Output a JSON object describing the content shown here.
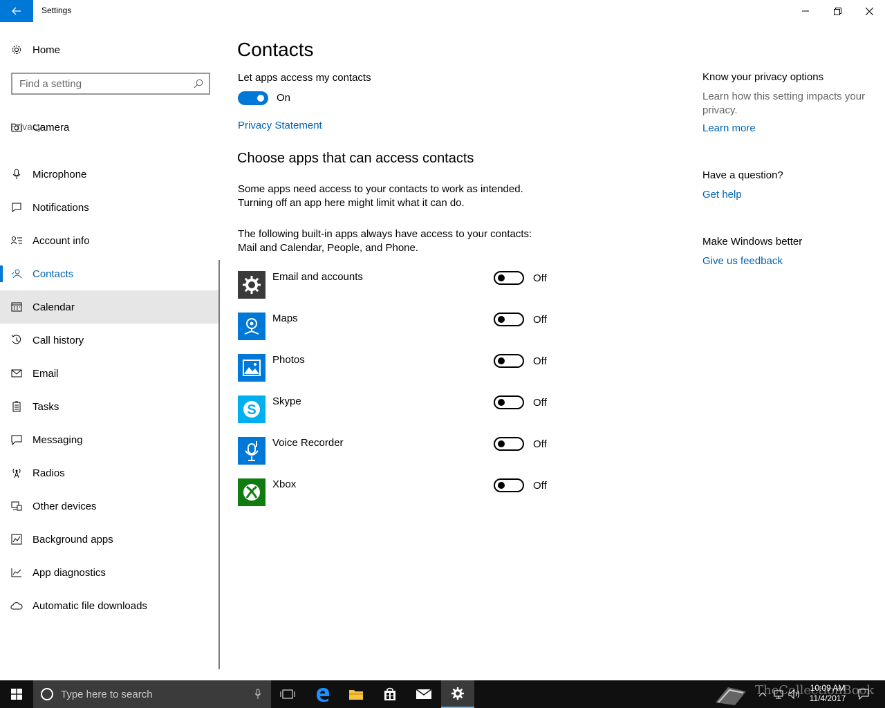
{
  "window": {
    "title": "Settings"
  },
  "sidebar": {
    "home_label": "Home",
    "search_placeholder": "Find a setting",
    "section_label": "Privacy",
    "items": [
      {
        "label": "Camera",
        "icon": "camera-icon"
      },
      {
        "label": "Microphone",
        "icon": "microphone-icon"
      },
      {
        "label": "Notifications",
        "icon": "notifications-icon"
      },
      {
        "label": "Account info",
        "icon": "account-info-icon"
      },
      {
        "label": "Contacts",
        "icon": "contacts-icon",
        "active": true
      },
      {
        "label": "Calendar",
        "icon": "calendar-icon",
        "hover": true
      },
      {
        "label": "Call history",
        "icon": "call-history-icon"
      },
      {
        "label": "Email",
        "icon": "email-icon"
      },
      {
        "label": "Tasks",
        "icon": "tasks-icon"
      },
      {
        "label": "Messaging",
        "icon": "messaging-icon"
      },
      {
        "label": "Radios",
        "icon": "radios-icon"
      },
      {
        "label": "Other devices",
        "icon": "other-devices-icon"
      },
      {
        "label": "Background apps",
        "icon": "background-apps-icon"
      },
      {
        "label": "App diagnostics",
        "icon": "app-diagnostics-icon"
      },
      {
        "label": "Automatic file downloads",
        "icon": "cloud-icon"
      }
    ]
  },
  "main": {
    "title": "Contacts",
    "master_setting_label": "Let apps access my contacts",
    "master_toggle_state": "On",
    "privacy_link": "Privacy Statement",
    "section_title": "Choose apps that can access contacts",
    "para1_line1": "Some apps need access to your contacts to work as intended.",
    "para1_line2": "Turning off an app here might limit what it can do.",
    "para2_line1": "The following built-in apps always have access to your contacts:",
    "para2_line2": "Mail and Calendar, People, and Phone.",
    "apps": [
      {
        "name": "Email and accounts",
        "state": "Off",
        "color": "#3a3a3a",
        "icon": "gear-icon"
      },
      {
        "name": "Maps",
        "state": "Off",
        "color": "#0078d7",
        "icon": "maps-icon"
      },
      {
        "name": "Photos",
        "state": "Off",
        "color": "#0078d7",
        "icon": "photos-icon"
      },
      {
        "name": "Skype",
        "state": "Off",
        "color": "#00aff0",
        "icon": "skype-icon"
      },
      {
        "name": "Voice Recorder",
        "state": "Off",
        "color": "#0078d7",
        "icon": "microphone-icon"
      },
      {
        "name": "Xbox",
        "state": "Off",
        "color": "#107c10",
        "icon": "xbox-icon"
      }
    ]
  },
  "right": {
    "privacy_head": "Know your privacy options",
    "privacy_text": "Learn how this setting impacts your privacy.",
    "learn_more": "Learn more",
    "question_head": "Have a question?",
    "get_help": "Get help",
    "better_head": "Make Windows better",
    "feedback": "Give us feedback"
  },
  "taskbar": {
    "search_placeholder": "Type here to search",
    "time": "10:09 AM",
    "date": "11/4/2017",
    "watermark": "TheCollectionBook"
  },
  "colors": {
    "accent": "#0078d7",
    "link": "#0063b1",
    "taskbar": "#101010"
  }
}
